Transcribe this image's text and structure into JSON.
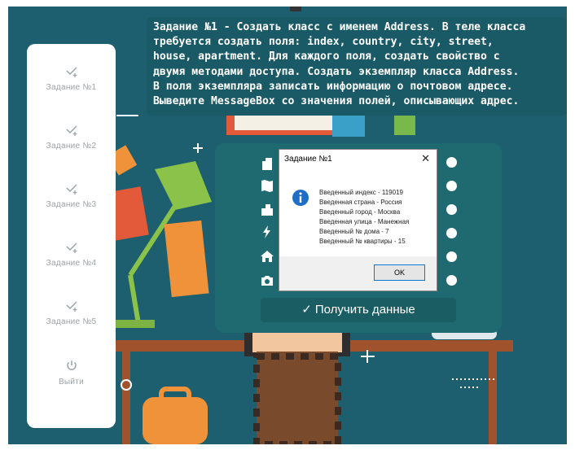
{
  "sidebar": {
    "items": [
      {
        "label": "Задание №1"
      },
      {
        "label": "Задание №2"
      },
      {
        "label": "Задание №3"
      },
      {
        "label": "Задание №4"
      },
      {
        "label": "Задание №5"
      }
    ],
    "exit_label": "Выйти"
  },
  "task": {
    "text": "Задание №1 - Создать класс с именем Address. В теле класса\nтребуется создать поля: index, country, city, street,\nhouse, apartment. Для каждого поля, создать свойство с\nдвумя методами доступа. Создать экземпляр класса Address.\nВ поля экземпляра записать информацию о почтовом адресе.\nВыведите MessageBox со значения полей, описывающих адрес."
  },
  "form": {
    "fields": [
      {
        "icon": "building-icon"
      },
      {
        "icon": "map-icon"
      },
      {
        "icon": "city-icon"
      },
      {
        "icon": "bolt-icon"
      },
      {
        "icon": "home-icon"
      },
      {
        "icon": "camera-icon"
      }
    ],
    "submit_label": "Получить данные"
  },
  "dialog": {
    "title": "Задание №1",
    "lines": [
      "Введенный индекс - 119019",
      "Введенная страна - Россия",
      "Введенный город - Москва",
      "Введенная улица - Манежная",
      "Введенный № дома - 7",
      "Введенный № квартиры - 15"
    ],
    "ok_label": "OK"
  },
  "colors": {
    "background": "#1d5f6e",
    "panel": "#1f6a70",
    "sidebar": "#ffffff",
    "accent_orange": "#e8833a",
    "accent_green": "#8bc34a"
  }
}
